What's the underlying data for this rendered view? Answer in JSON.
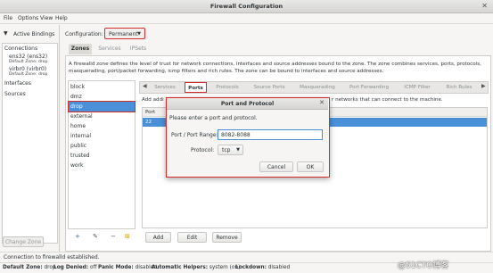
{
  "window": {
    "title": "Firewall Configuration",
    "close_glyph": "✕"
  },
  "menu": [
    "File",
    "Options",
    "View",
    "Help"
  ],
  "left_panel": {
    "active_bindings_label": "Active Bindings",
    "connections_header": "Connections",
    "connections": [
      {
        "name": "ens32 (ens32)",
        "zone": "Default Zone: drop"
      },
      {
        "name": "virbr0 (virbr0)",
        "zone": "Default Zone: drop"
      }
    ],
    "interfaces_header": "Interfaces",
    "sources_header": "Sources",
    "change_zone_label": "Change Zone"
  },
  "configuration": {
    "label": "Configuration:",
    "value": "Permanent"
  },
  "main_tabs": [
    "Zones",
    "Services",
    "IPSets"
  ],
  "zone_description": "A firewalld zone defines the level of trust for network connections, interfaces and source addresses bound to the zone. The zone combines services, ports, protocols, masquerading, port/packet forwarding, icmp filters and rich rules. The zone can be bound to interfaces and source addresses.",
  "zones": [
    "block",
    "dmz",
    "drop",
    "external",
    "home",
    "internal",
    "public",
    "trusted",
    "work"
  ],
  "selected_zone": "drop",
  "zone_tools": [
    "+",
    "✎",
    "−",
    "⊞"
  ],
  "sub_tabs": [
    "Services",
    "Ports",
    "Protocols",
    "Source Ports",
    "Masquerading",
    "Port Forwarding",
    "ICMP Filter",
    "Rich Rules"
  ],
  "active_sub_tab": "Ports",
  "ports_panel": {
    "intro_left": "Add addi",
    "intro_right": "r networks that can connect to the machine.",
    "column_header": "Port",
    "rows": [
      "22"
    ],
    "add_label": "Add",
    "edit_label": "Edit",
    "remove_label": "Remove"
  },
  "dialog": {
    "title": "Port and Protocol",
    "message": "Please enter a port and protocol.",
    "port_label": "Port / Port Range:",
    "port_value": "8082-8088",
    "protocol_label": "Protocol:",
    "protocol_value": "tcp",
    "cancel_label": "Cancel",
    "ok_label": "OK"
  },
  "status": {
    "connection": "Connection to firewalld established.",
    "items": [
      {
        "label": "Default Zone:",
        "value": "drop"
      },
      {
        "label": "Log Denied:",
        "value": "off"
      },
      {
        "label": "Panic Mode:",
        "value": "disabled"
      },
      {
        "label": "Automatic Helpers:",
        "value": "system (on)"
      },
      {
        "label": "Lockdown:",
        "value": "disabled"
      }
    ]
  },
  "watermark": "@51CTO博客",
  "colors": {
    "selection": "#4a90d9",
    "highlight_border": "#d42b2b"
  }
}
